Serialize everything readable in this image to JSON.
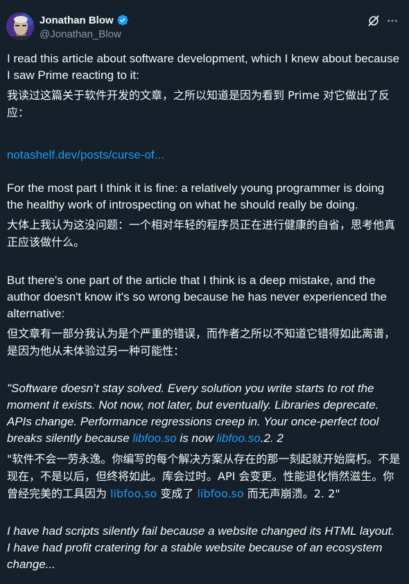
{
  "author": {
    "name": "Jonathan Blow",
    "handle": "@Jonathan_Blow"
  },
  "icons": {
    "avatar": "avatar-image",
    "verified": "verified-badge-icon",
    "grok": "grok-icon",
    "more": "more-options-icon"
  },
  "colors": {
    "background": "#15202b",
    "text": "#f7f9f9",
    "secondary": "#8b98a5",
    "link": "#1d9bf0"
  },
  "post": {
    "p1_en": "I read this article about software development, which I knew about because I saw Prime reacting to it:",
    "p1_zh": "我读过这篇关于软件开发的文章，之所以知道是因为看到 Prime 对它做出了反应：",
    "link_text": "notashelf.dev/posts/curse-of...",
    "p2_en": "For the most part I think it is fine: a relatively young programmer is doing the healthy work of introspecting on what he should really be doing.",
    "p2_zh": "大体上我认为这没问题：一个相对年轻的程序员正在进行健康的自省，思考他真正应该做什么。",
    "p3_en": "But there's one part of the article that I think is a deep mistake, and the author doesn't know it's so wrong because he has never experienced the alternative:",
    "p3_zh": "但文章有一部分我认为是个严重的错误，而作者之所以不知道它错得如此离谱，是因为他从未体验过另一种可能性：",
    "quote_en_a": "\"Software doesn’t stay solved. Every solution you write starts to rot the moment it exists. Not now, not later, but eventually. Libraries deprecate. APIs change. Performance regressions creep in. Your once-perfect tool breaks silently because ",
    "quote_en_link1": "libfoo.so",
    "quote_en_b": " is now ",
    "quote_en_link2": "libfoo.so",
    "quote_en_c": ".2. 2",
    "quote_zh_a": "\"软件不会一劳永逸。你编写的每个解决方案从存在的那一刻起就开始腐朽。不是现在，不是以后，但终将如此。库会过时。API 会变更。性能退化悄然滋生。你曾经完美的工具因为 ",
    "quote_zh_link1": "libfoo.so",
    "quote_zh_b": " 变成了 ",
    "quote_zh_link2": "libfoo.so",
    "quote_zh_c": " 而无声崩溃。2. 2\"",
    "p5_en": "I have had scripts silently fail because a website changed its HTML layout.",
    "p6_en": "I have had profit cratering for a stable website because of an ecosystem change..."
  }
}
